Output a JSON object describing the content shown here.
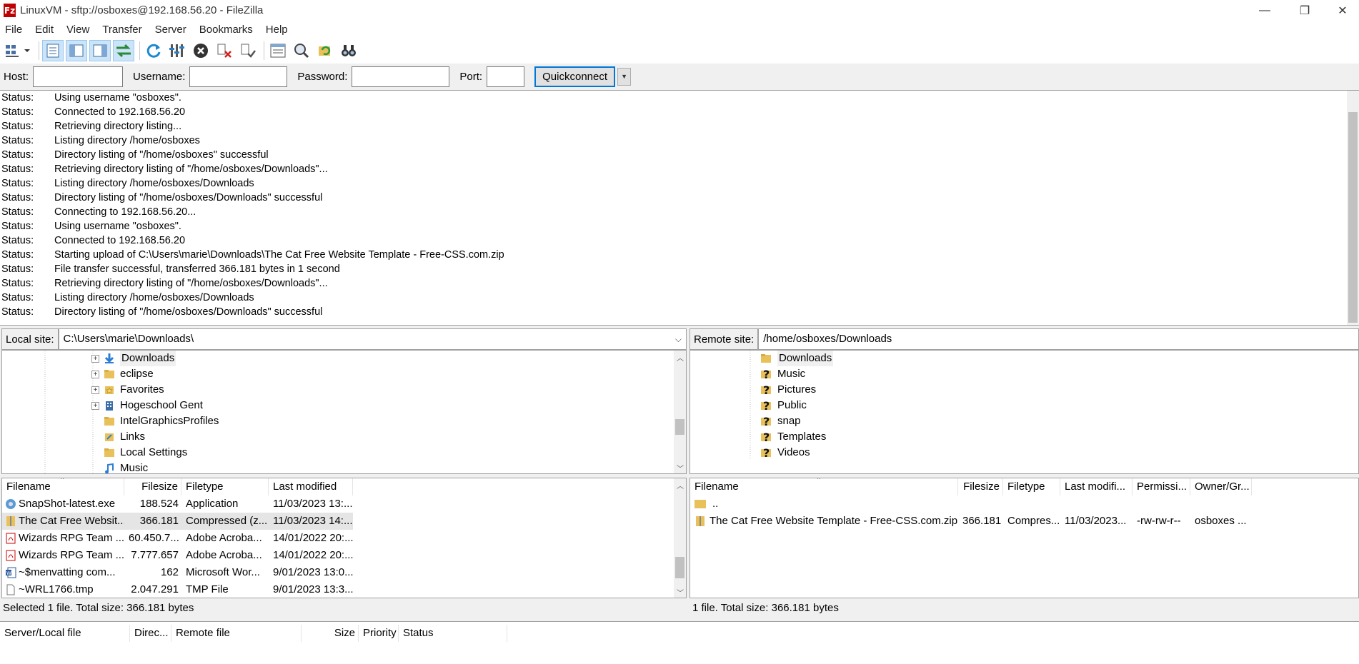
{
  "window": {
    "app_icon_label": "Fz",
    "title": "LinuxVM - sftp://osboxes@192.168.56.20 - FileZilla",
    "minimize": "—",
    "maximize": "❐",
    "close": "✕"
  },
  "menu": [
    "File",
    "Edit",
    "View",
    "Transfer",
    "Server",
    "Bookmarks",
    "Help"
  ],
  "quickconnect": {
    "host_label": "Host:",
    "host_value": "",
    "username_label": "Username:",
    "username_value": "",
    "password_label": "Password:",
    "password_value": "",
    "port_label": "Port:",
    "port_value": "",
    "button": "Quickconnect",
    "dropdown_icon": "▼"
  },
  "log": [
    {
      "type": "Status:",
      "msg": "Using username \"osboxes\"."
    },
    {
      "type": "Status:",
      "msg": "Connected to 192.168.56.20"
    },
    {
      "type": "Status:",
      "msg": "Retrieving directory listing..."
    },
    {
      "type": "Status:",
      "msg": "Listing directory /home/osboxes"
    },
    {
      "type": "Status:",
      "msg": "Directory listing of \"/home/osboxes\" successful"
    },
    {
      "type": "Status:",
      "msg": "Retrieving directory listing of \"/home/osboxes/Downloads\"..."
    },
    {
      "type": "Status:",
      "msg": "Listing directory /home/osboxes/Downloads"
    },
    {
      "type": "Status:",
      "msg": "Directory listing of \"/home/osboxes/Downloads\" successful"
    },
    {
      "type": "Status:",
      "msg": "Connecting to 192.168.56.20..."
    },
    {
      "type": "Status:",
      "msg": "Using username \"osboxes\"."
    },
    {
      "type": "Status:",
      "msg": "Connected to 192.168.56.20"
    },
    {
      "type": "Status:",
      "msg": "Starting upload of C:\\Users\\marie\\Downloads\\The Cat Free Website Template - Free-CSS.com.zip"
    },
    {
      "type": "Status:",
      "msg": "File transfer successful, transferred 366.181 bytes in 1 second"
    },
    {
      "type": "Status:",
      "msg": "Retrieving directory listing of \"/home/osboxes/Downloads\"..."
    },
    {
      "type": "Status:",
      "msg": "Listing directory /home/osboxes/Downloads"
    },
    {
      "type": "Status:",
      "msg": "Directory listing of \"/home/osboxes/Downloads\" successful"
    }
  ],
  "local": {
    "site_label": "Local site:",
    "path": "C:\\Users\\marie\\Downloads\\",
    "tree": [
      {
        "name": "Downloads",
        "expander": "+",
        "icon": "download-arrow-icon"
      },
      {
        "name": "eclipse",
        "expander": "+",
        "icon": "folder-icon"
      },
      {
        "name": "Favorites",
        "expander": "+",
        "icon": "star-folder-icon"
      },
      {
        "name": "Hogeschool Gent",
        "expander": "+",
        "icon": "building-icon"
      },
      {
        "name": "IntelGraphicsProfiles",
        "expander": "",
        "icon": "folder-icon"
      },
      {
        "name": "Links",
        "expander": "",
        "icon": "links-icon"
      },
      {
        "name": "Local Settings",
        "expander": "",
        "icon": "folder-icon"
      },
      {
        "name": "Music",
        "expander": "",
        "icon": "music-note-icon"
      }
    ],
    "columns": [
      "Filename",
      "Filesize",
      "Filetype",
      "Last modified"
    ],
    "files": [
      {
        "name": "SnapShot-latest.exe",
        "size": "188.524",
        "type": "Application",
        "modified": "11/03/2023 13:...",
        "icon": "application-icon"
      },
      {
        "name": "The Cat Free Websit...",
        "size": "366.181",
        "type": "Compressed (z...",
        "modified": "11/03/2023 14:...",
        "icon": "zip-icon",
        "selected": true
      },
      {
        "name": "Wizards RPG Team ...",
        "size": "60.450.7...",
        "type": "Adobe Acroba...",
        "modified": "14/01/2022 20:...",
        "icon": "pdf-icon"
      },
      {
        "name": "Wizards RPG Team ...",
        "size": "7.777.657",
        "type": "Adobe Acroba...",
        "modified": "14/01/2022 20:...",
        "icon": "pdf-icon"
      },
      {
        "name": "~$menvatting com...",
        "size": "162",
        "type": "Microsoft Wor...",
        "modified": "9/01/2023 13:0...",
        "icon": "word-icon"
      },
      {
        "name": "~WRL1766.tmp",
        "size": "2.047.291",
        "type": "TMP File",
        "modified": "9/01/2023 13:3...",
        "icon": "file-icon"
      }
    ],
    "status": "Selected 1 file. Total size: 366.181 bytes"
  },
  "remote": {
    "site_label": "Remote site:",
    "path": "/home/osboxes/Downloads",
    "tree": [
      {
        "name": "Downloads",
        "icon": "folder-icon"
      },
      {
        "name": "Music",
        "icon": "question-mark-icon"
      },
      {
        "name": "Pictures",
        "icon": "question-mark-icon"
      },
      {
        "name": "Public",
        "icon": "question-mark-icon"
      },
      {
        "name": "snap",
        "icon": "question-mark-icon"
      },
      {
        "name": "Templates",
        "icon": "question-mark-icon"
      },
      {
        "name": "Videos",
        "icon": "question-mark-icon"
      }
    ],
    "columns": [
      "Filename",
      "Filesize",
      "Filetype",
      "Last modifi...",
      "Permissi...",
      "Owner/Gr..."
    ],
    "parent_dir": "..",
    "files": [
      {
        "name": "The Cat Free Website Template - Free-CSS.com.zip",
        "size": "366.181",
        "type": "Compres...",
        "modified": "11/03/2023...",
        "perms": "-rw-rw-r--",
        "owner": "osboxes ..."
      }
    ],
    "status": "1 file. Total size: 366.181 bytes"
  },
  "queue": {
    "columns": [
      "Server/Local file",
      "Direc...",
      "Remote file",
      "Size",
      "Priority",
      "Status"
    ]
  },
  "colors": {
    "accent": "#0078d7",
    "folder": "#e8c15a",
    "selection": "#e5e5e5",
    "app_icon": "#bf0000"
  }
}
